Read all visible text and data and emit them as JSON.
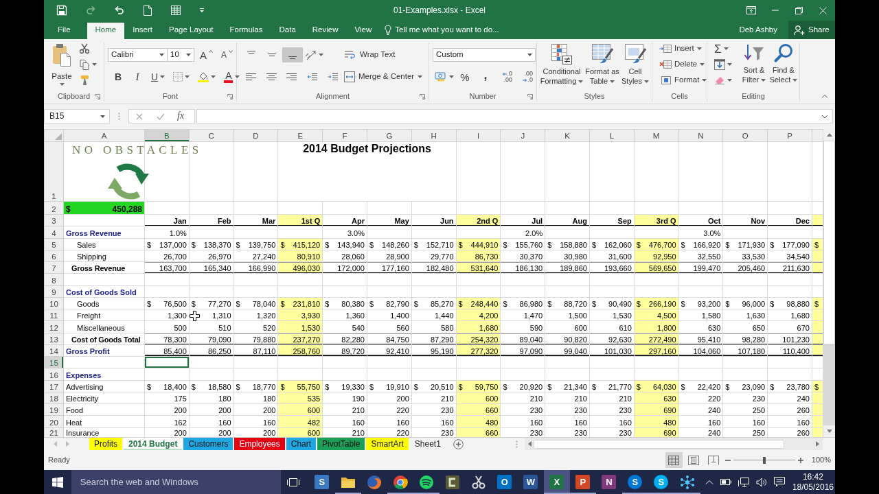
{
  "window": {
    "title": "01-Examples.xlsx - Excel"
  },
  "quick_access": [
    {
      "kind": "save",
      "disabled": false
    },
    {
      "kind": "redo",
      "disabled": true
    },
    {
      "kind": "undo",
      "disabled": false
    },
    {
      "kind": "new",
      "disabled": false
    },
    {
      "kind": "form",
      "disabled": false
    },
    {
      "kind": "customize",
      "disabled": false
    }
  ],
  "ribbon_tabs": [
    {
      "label": "File",
      "selected": false
    },
    {
      "label": "Home",
      "selected": true
    },
    {
      "label": "Insert",
      "selected": false
    },
    {
      "label": "Page Layout",
      "selected": false
    },
    {
      "label": "Formulas",
      "selected": false
    },
    {
      "label": "Data",
      "selected": false
    },
    {
      "label": "Review",
      "selected": false
    },
    {
      "label": "View",
      "selected": false
    }
  ],
  "tell_me": {
    "placeholder": "Tell me what you want to do..."
  },
  "user": "Deb Ashby",
  "share": "Share",
  "ribbon": {
    "clipboard": {
      "paste": "Paste",
      "label": "Clipboard"
    },
    "font": {
      "name": "Calibri",
      "size": "10",
      "grow": "A",
      "shrink": "A",
      "bold": "B",
      "italic": "I",
      "underline": "U",
      "text_color_button": "A",
      "label": "Font"
    },
    "alignment": {
      "vertical": [
        {
          "kind": "top",
          "selected": false
        },
        {
          "kind": "middle",
          "selected": false
        },
        {
          "kind": "bottom",
          "selected": true
        }
      ],
      "wrap_text": "Wrap Text",
      "merge": "Merge & Center",
      "label": "Alignment"
    },
    "number": {
      "format": "Custom",
      "percent": "%",
      "comma": ",",
      "decimals": [
        {
          "kind": "increase",
          "lines": [
            ".0",
            ".00"
          ]
        },
        {
          "kind": "decrease",
          "lines": [
            ".00",
            ".0"
          ]
        }
      ],
      "label": "Number"
    },
    "styles": {
      "buttons": [
        {
          "kind": "conditional",
          "label": "Conditional Formatting"
        },
        {
          "kind": "table",
          "label": "Format as Table"
        },
        {
          "kind": "cell",
          "label": "Cell Styles"
        }
      ],
      "label": "Styles"
    },
    "cells": {
      "buttons": [
        {
          "kind": "insert",
          "label": "Insert"
        },
        {
          "kind": "delete",
          "label": "Delete"
        },
        {
          "kind": "format",
          "label": "Format"
        }
      ],
      "label": "Cells"
    },
    "editing": {
      "autosum": "Σ",
      "buttons": [
        {
          "kind": "sort",
          "label": "Sort & Filter"
        },
        {
          "kind": "find",
          "label": "Find & Select"
        }
      ],
      "label": "Editing"
    }
  },
  "name_box": "B15",
  "formula_bar": {
    "fx": "fx"
  },
  "sheet": {
    "logo": "NO OBSTACLES",
    "columns": [
      {
        "label": "A",
        "selected": false,
        "highlighted": false
      },
      {
        "label": "B",
        "selected": true,
        "highlighted": false
      },
      {
        "label": "C",
        "selected": false,
        "highlighted": false
      },
      {
        "label": "D",
        "selected": false,
        "highlighted": false
      },
      {
        "label": "E",
        "selected": false,
        "highlighted": true
      },
      {
        "label": "F",
        "selected": false,
        "highlighted": false
      },
      {
        "label": "G",
        "selected": false,
        "highlighted": false
      },
      {
        "label": "H",
        "selected": false,
        "highlighted": false
      },
      {
        "label": "I",
        "selected": false,
        "highlighted": true
      },
      {
        "label": "J",
        "selected": false,
        "highlighted": false
      },
      {
        "label": "K",
        "selected": false,
        "highlighted": false
      },
      {
        "label": "L",
        "selected": false,
        "highlighted": false
      },
      {
        "label": "M",
        "selected": false,
        "highlighted": true
      },
      {
        "label": "N",
        "selected": false,
        "highlighted": false
      },
      {
        "label": "O",
        "selected": false,
        "highlighted": false
      },
      {
        "label": "P",
        "selected": false,
        "highlighted": false
      },
      {
        "selected": false,
        "highlighted": true
      }
    ],
    "rows": [
      {
        "number": "1",
        "kind": "title",
        "selected": false,
        "highlighted": false,
        "cells": [
          null,
          null,
          null,
          null,
          "2014 Budget Projections"
        ]
      },
      {
        "number": "2",
        "kind": "banner",
        "selected": false,
        "highlighted": false,
        "cells": [
          {
            "symbol": "$",
            "value": "450,288"
          }
        ]
      },
      {
        "number": "3",
        "kind": "header",
        "selected": false,
        "highlighted": true,
        "cells": [
          null,
          "Jan",
          "Feb",
          "Mar",
          "1st Q",
          "Apr",
          "May",
          "Jun",
          "2nd Q",
          "Jul",
          "Aug",
          "Sep",
          "3rd Q",
          "Oct",
          "Nov",
          "Dec"
        ]
      },
      {
        "number": "4",
        "kind": "section",
        "selected": false,
        "highlighted": false,
        "cells": [
          "Gross Revenue",
          "1.0%",
          null,
          null,
          null,
          "3.0%",
          null,
          null,
          null,
          "2.0%",
          null,
          null,
          null,
          "3.0%"
        ]
      },
      {
        "number": "5",
        "kind": "item",
        "selected": false,
        "highlighted": true,
        "cells": [
          "Sales",
          {
            "symbol": "$",
            "value": "137,000"
          },
          {
            "symbol": "$",
            "value": "138,370"
          },
          {
            "symbol": "$",
            "value": "139,750"
          },
          {
            "symbol": "$",
            "value": "415,120"
          },
          {
            "symbol": "$",
            "value": "143,940"
          },
          {
            "symbol": "$",
            "value": "148,260"
          },
          {
            "symbol": "$",
            "value": "152,710"
          },
          {
            "symbol": "$",
            "value": "444,910"
          },
          {
            "symbol": "$",
            "value": "155,760"
          },
          {
            "symbol": "$",
            "value": "158,880"
          },
          {
            "symbol": "$",
            "value": "162,060"
          },
          {
            "symbol": "$",
            "value": "476,700"
          },
          {
            "symbol": "$",
            "value": "166,920"
          },
          {
            "symbol": "$",
            "value": "171,930"
          },
          {
            "symbol": "$",
            "value": "177,090"
          },
          {
            "symbol": "$"
          }
        ]
      },
      {
        "number": "6",
        "kind": "item",
        "selected": false,
        "highlighted": true,
        "cells": [
          "Shipping",
          "26,700",
          "26,970",
          "27,240",
          "80,910",
          "28,060",
          "28,900",
          "29,770",
          "86,730",
          "30,370",
          "30,980",
          "31,600",
          "92,950",
          "32,550",
          "33,530",
          "34,540"
        ]
      },
      {
        "number": "7",
        "kind": "total",
        "selected": false,
        "highlighted": true,
        "cells": [
          "Gross Revenue",
          "163,700",
          "165,340",
          "166,990",
          "496,030",
          "172,000",
          "177,160",
          "182,480",
          "531,640",
          "186,130",
          "189,860",
          "193,660",
          "569,650",
          "199,470",
          "205,460",
          "211,630"
        ]
      },
      {
        "number": "8",
        "kind": "blank",
        "selected": false,
        "highlighted": false
      },
      {
        "number": "9",
        "kind": "section",
        "selected": false,
        "highlighted": false,
        "cells": [
          "Cost of Goods Sold"
        ]
      },
      {
        "number": "10",
        "kind": "item",
        "selected": false,
        "highlighted": true,
        "cells": [
          "Goods",
          {
            "symbol": "$",
            "value": "76,500"
          },
          {
            "symbol": "$",
            "value": "77,270"
          },
          {
            "symbol": "$",
            "value": "78,040"
          },
          {
            "symbol": "$",
            "value": "231,810"
          },
          {
            "symbol": "$",
            "value": "80,380"
          },
          {
            "symbol": "$",
            "value": "82,790"
          },
          {
            "symbol": "$",
            "value": "85,270"
          },
          {
            "symbol": "$",
            "value": "248,440"
          },
          {
            "symbol": "$",
            "value": "86,980"
          },
          {
            "symbol": "$",
            "value": "88,720"
          },
          {
            "symbol": "$",
            "value": "90,490"
          },
          {
            "symbol": "$",
            "value": "266,190"
          },
          {
            "symbol": "$",
            "value": "93,200"
          },
          {
            "symbol": "$",
            "value": "96,000"
          },
          {
            "symbol": "$",
            "value": "98,880"
          },
          {
            "symbol": "$"
          }
        ]
      },
      {
        "number": "11",
        "kind": "item",
        "selected": false,
        "highlighted": true,
        "cells": [
          "Freight",
          "1,300",
          "1,310",
          "1,320",
          "3,930",
          "1,360",
          "1,400",
          "1,440",
          "4,200",
          "1,470",
          "1,500",
          "1,530",
          "4,500",
          "1,580",
          "1,630",
          "1,680"
        ]
      },
      {
        "number": "12",
        "kind": "item",
        "selected": false,
        "highlighted": true,
        "cells": [
          "Miscellaneous",
          "500",
          "510",
          "520",
          "1,530",
          "540",
          "560",
          "580",
          "1,680",
          "590",
          "600",
          "610",
          "1,800",
          "630",
          "650",
          "670"
        ]
      },
      {
        "number": "13",
        "kind": "total",
        "selected": false,
        "highlighted": true,
        "cells": [
          "Cost of Goods Total",
          "78,300",
          "79,090",
          "79,880",
          "237,270",
          "82,280",
          "84,750",
          "87,290",
          "254,320",
          "89,040",
          "90,820",
          "92,630",
          "272,490",
          "95,410",
          "98,280",
          "101,230"
        ]
      },
      {
        "number": "14",
        "kind": "profit",
        "selected": false,
        "highlighted": true,
        "cells": [
          "Gross Profit",
          "85,400",
          "86,250",
          "87,110",
          "258,760",
          "89,720",
          "92,410",
          "95,190",
          "277,320",
          "97,090",
          "99,040",
          "101,030",
          "297,160",
          "104,060",
          "107,180",
          "110,400"
        ]
      },
      {
        "number": "15",
        "kind": "blank",
        "selected": true,
        "highlighted": false
      },
      {
        "number": "16",
        "kind": "section",
        "selected": false,
        "highlighted": false,
        "cells": [
          "Expenses"
        ]
      },
      {
        "number": "17",
        "kind": "expense",
        "selected": false,
        "highlighted": true,
        "cells": [
          "Advertising",
          {
            "symbol": "$",
            "value": "18,400"
          },
          {
            "symbol": "$",
            "value": "18,580"
          },
          {
            "symbol": "$",
            "value": "18,770"
          },
          {
            "symbol": "$",
            "value": "55,750"
          },
          {
            "symbol": "$",
            "value": "19,330"
          },
          {
            "symbol": "$",
            "value": "19,910"
          },
          {
            "symbol": "$",
            "value": "20,510"
          },
          {
            "symbol": "$",
            "value": "59,750"
          },
          {
            "symbol": "$",
            "value": "20,920"
          },
          {
            "symbol": "$",
            "value": "21,340"
          },
          {
            "symbol": "$",
            "value": "21,770"
          },
          {
            "symbol": "$",
            "value": "64,030"
          },
          {
            "symbol": "$",
            "value": "22,420"
          },
          {
            "symbol": "$",
            "value": "23,090"
          },
          {
            "symbol": "$",
            "value": "23,780"
          },
          {
            "symbol": "$"
          }
        ]
      },
      {
        "number": "18",
        "kind": "expense",
        "selected": false,
        "highlighted": true,
        "cells": [
          "Electricity",
          "175",
          "180",
          "180",
          "535",
          "190",
          "200",
          "210",
          "600",
          "210",
          "210",
          "210",
          "630",
          "220",
          "230",
          "240"
        ]
      },
      {
        "number": "19",
        "kind": "expense",
        "selected": false,
        "highlighted": true,
        "cells": [
          "Food",
          "200",
          "200",
          "200",
          "600",
          "210",
          "220",
          "230",
          "660",
          "230",
          "230",
          "230",
          "690",
          "240",
          "250",
          "260"
        ]
      },
      {
        "number": "20",
        "kind": "expense",
        "selected": false,
        "highlighted": true,
        "cells": [
          "Heat",
          "162",
          "160",
          "160",
          "482",
          "160",
          "160",
          "160",
          "480",
          "160",
          "160",
          "160",
          "480",
          "160",
          "160",
          "160"
        ]
      },
      {
        "number": "21",
        "kind": "expense",
        "selected": false,
        "highlighted": true,
        "cells": [
          "Insurance",
          "200",
          "200",
          "200",
          "600",
          "210",
          "220",
          "230",
          "660",
          "230",
          "230",
          "230",
          "690",
          "240",
          "250",
          "260"
        ]
      }
    ]
  },
  "sheet_tabs": [
    {
      "label": "Profits",
      "color": "#ffff00",
      "selected": false
    },
    {
      "label": "2014 Budget",
      "selected": true
    },
    {
      "label": "Customers",
      "color": "#1ea7e1",
      "selected": false
    },
    {
      "label": "Employees",
      "color": "#e60012",
      "selected": false
    },
    {
      "label": "Chart",
      "color": "#1ea7e1",
      "selected": false
    },
    {
      "label": "PivotTable",
      "color": "#1b9e57",
      "selected": false
    },
    {
      "label": "SmartArt",
      "color": "#ffff00",
      "selected": false
    },
    {
      "label": "Sheet1",
      "selected": false
    }
  ],
  "status_bar": {
    "status": "Ready",
    "views": [
      {
        "kind": "normal",
        "selected": true
      },
      {
        "kind": "page_layout",
        "selected": false
      },
      {
        "kind": "page_break",
        "selected": false
      }
    ],
    "zoom": {
      "level": 0.5,
      "reading": "100%"
    }
  },
  "taskbar": {
    "search": {
      "placeholder": "Search the web and Windows"
    },
    "apps": [
      {
        "kind": "tile",
        "glyph": "S",
        "color": "#3a78c2",
        "selected": false,
        "running": false
      },
      {
        "kind": "folder",
        "selected": false,
        "running": true
      },
      {
        "kind": "globe",
        "selected": false,
        "running": false
      },
      {
        "kind": "ring",
        "selected": false,
        "running": true
      },
      {
        "kind": "waves",
        "selected": false,
        "running": true
      },
      {
        "kind": "frame",
        "selected": false,
        "running": false
      },
      {
        "kind": "scissors",
        "selected": false,
        "running": false
      },
      {
        "kind": "tile",
        "glyph": "O",
        "color": "#0072c6",
        "selected": false,
        "running": false
      },
      {
        "kind": "tile",
        "glyph": "W",
        "color": "#2b579a",
        "selected": false,
        "running": false
      },
      {
        "kind": "tile",
        "glyph": "X",
        "color": "#217346",
        "selected": true,
        "running": true
      },
      {
        "kind": "tile",
        "glyph": "P",
        "color": "#d24726",
        "selected": false,
        "running": true
      },
      {
        "kind": "tile",
        "glyph": "N",
        "color": "#80397b",
        "selected": false,
        "running": false
      },
      {
        "kind": "circle",
        "glyph": "S",
        "color": "#0078d7",
        "selected": false,
        "running": true
      },
      {
        "kind": "circle",
        "glyph": "S",
        "color": "#00aff0",
        "selected": false,
        "running": true
      },
      {
        "kind": "nodes",
        "selected": false,
        "running": true
      }
    ],
    "time": "16:42",
    "date": "18/05/2016"
  }
}
